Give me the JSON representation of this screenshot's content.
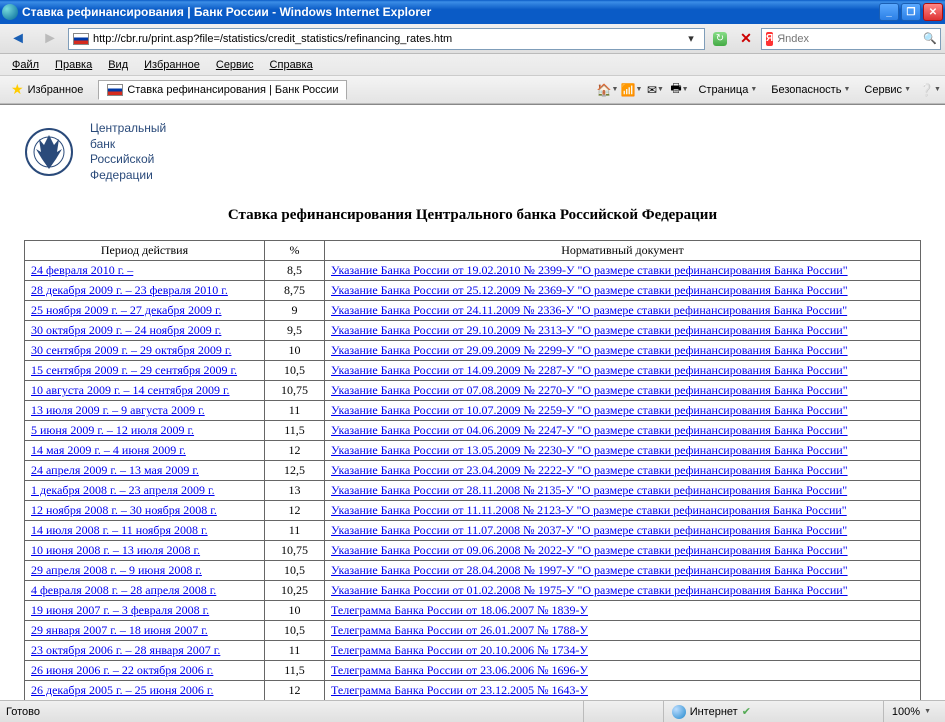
{
  "window": {
    "title": "Ставка рефинансирования | Банк России - Windows Internet Explorer"
  },
  "address": {
    "url": "http://cbr.ru/print.asp?file=/statistics/credit_statistics/refinancing_rates.htm",
    "search_placeholder": "Яndex"
  },
  "menus": [
    "Файл",
    "Правка",
    "Вид",
    "Избранное",
    "Сервис",
    "Справка"
  ],
  "favbar": {
    "favorites": "Избранное",
    "tab": "Ставка рефинансирования | Банк России"
  },
  "cmdbar": {
    "page": "Страница",
    "safety": "Безопасность",
    "tools": "Сервис"
  },
  "page": {
    "bank_name_1": "Центральный",
    "bank_name_2": "банк",
    "bank_name_3": "Российской",
    "bank_name_4": "Федерации",
    "title": "Ставка рефинансирования Центрального банка Российской Федерации",
    "col1": "Период действия",
    "col2": "%",
    "col3": "Нормативный документ",
    "doc_prefix_ukaz_short": "Указание Банка России от ",
    "doc_suffix_refinance": " \"О размере ставки рефинансирования Банка России\"",
    "doc_prefix_tele": "Телеграмма Банка России от "
  },
  "rows": [
    {
      "period": "24 февраля 2010 г. –",
      "pct": "8,5",
      "doc_date": "19.02.2010",
      "num": "№ 2399-У",
      "type": "ukaz"
    },
    {
      "period": "28 декабря  2009 г. – 23 февраля 2010 г.",
      "pct": "8,75",
      "doc_date": "25.12.2009",
      "num": "№ 2369-У",
      "type": "ukaz"
    },
    {
      "period": "25 ноября 2009 г. – 27 декабря 2009 г.",
      "pct": "9",
      "doc_date": "24.11.2009",
      "num": "№ 2336-У",
      "type": "ukaz"
    },
    {
      "period": "30 октября 2009 г. – 24 ноября 2009 г.",
      "pct": "9,5",
      "doc_date": "29.10.2009",
      "num": "№ 2313-У",
      "type": "ukaz"
    },
    {
      "period": "30 сентября 2009 г. – 29 октября 2009 г.",
      "pct": "10",
      "doc_date": "29.09.2009",
      "num": "№ 2299-У",
      "type": "ukaz"
    },
    {
      "period": "15 сентября 2009 г. – 29 сентября 2009 г.",
      "pct": "10,5",
      "doc_date": "14.09.2009",
      "num": "№ 2287-У",
      "type": "ukaz"
    },
    {
      "period": "10 августа 2009 г. – 14 сентября 2009 г.",
      "pct": "10,75",
      "doc_date": "07.08.2009",
      "num": "№ 2270-У",
      "type": "ukaz"
    },
    {
      "period": "13 июля 2009 г. – 9 августа 2009 г.",
      "pct": "11",
      "doc_date": "10.07.2009",
      "num": "№ 2259-У",
      "type": "ukaz"
    },
    {
      "period": "5 июня 2009 г. – 12 июля 2009 г.",
      "pct": "11,5",
      "doc_date": "04.06.2009",
      "num": "№ 2247-У",
      "type": "ukaz"
    },
    {
      "period": "14 мая 2009 г. – 4 июня 2009 г.",
      "pct": "12",
      "doc_date": "13.05.2009",
      "num": "№ 2230-У",
      "type": "ukaz"
    },
    {
      "period": "24 апреля 2009 г. – 13 мая 2009 г.",
      "pct": "12,5",
      "doc_date": "23.04.2009",
      "num": "№ 2222-У",
      "type": "ukaz"
    },
    {
      "period": "1 декабря 2008 г. – 23 апреля 2009 г.",
      "pct": "13",
      "doc_date": "28.11.2008",
      "num": "№ 2135-У",
      "type": "ukaz"
    },
    {
      "period": "12 ноября 2008 г. – 30 ноября 2008 г.",
      "pct": "12",
      "doc_date": "11.11.2008",
      "num": "№ 2123-У",
      "type": "ukaz"
    },
    {
      "period": "14 июля 2008 г. – 11 ноября 2008 г.",
      "pct": "11",
      "doc_date": "11.07.2008",
      "num": "№ 2037-У",
      "type": "ukaz"
    },
    {
      "period": "10 июня 2008 г. – 13 июля 2008 г.",
      "pct": "10,75",
      "doc_date": "09.06.2008",
      "num": "№ 2022-У",
      "type": "ukaz"
    },
    {
      "period": "29 апреля 2008 г. – 9 июня 2008 г.",
      "pct": "10,5",
      "doc_date": "28.04.2008",
      "num": "№ 1997-У",
      "type": "ukaz"
    },
    {
      "period": "4 февраля 2008 г. – 28 апреля 2008 г.",
      "pct": "10,25",
      "doc_date": "01.02.2008",
      "num": "№ 1975-У",
      "type": "ukaz"
    },
    {
      "period": "19 июня 2007 г. – 3 февраля 2008 г.",
      "pct": "10",
      "doc_date": "18.06.2007",
      "num": "№ 1839-У",
      "type": "tele"
    },
    {
      "period": "29 января 2007 г. – 18 июня 2007 г.",
      "pct": "10,5",
      "doc_date": "26.01.2007",
      "num": "№ 1788-У",
      "type": "tele"
    },
    {
      "period": "23 октября 2006 г. – 28 января 2007 г.",
      "pct": "11",
      "doc_date": "20.10.2006",
      "num": "№ 1734-У",
      "type": "tele"
    },
    {
      "period": "26 июня 2006 г. – 22 октября 2006 г.",
      "pct": "11,5",
      "doc_date": "23.06.2006",
      "num": "№ 1696-У",
      "type": "tele"
    },
    {
      "period": "26 декабря 2005 г. – 25 июня 2006 г.",
      "pct": "12",
      "doc_date": "23.12.2005",
      "num": "№ 1643-У",
      "type": "tele"
    }
  ],
  "status": {
    "ready": "Готово",
    "zone": "Интернет",
    "zoom": "100%"
  }
}
